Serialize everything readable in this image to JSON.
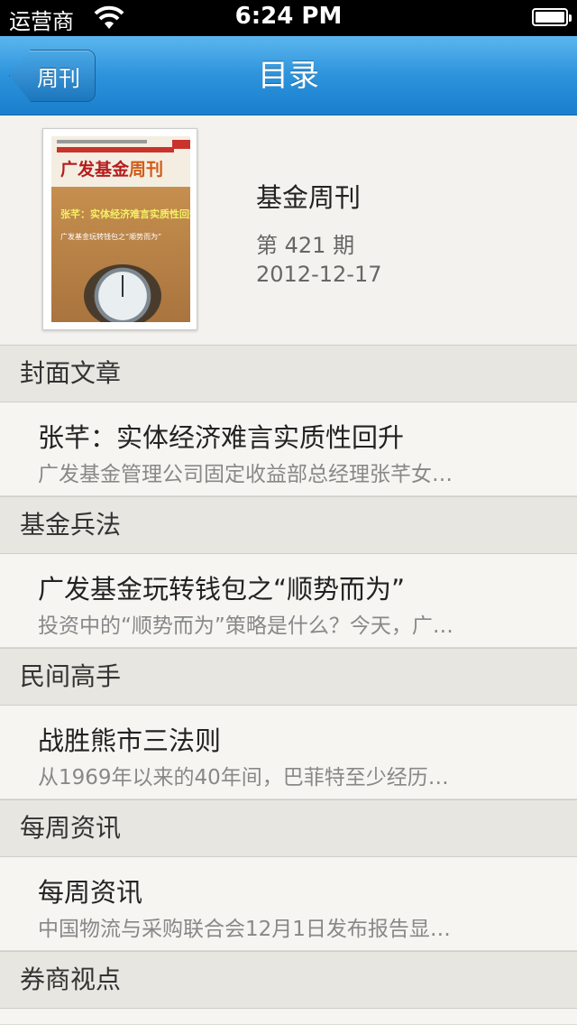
{
  "status_bar": {
    "carrier": "运营商",
    "time": "6:24 PM"
  },
  "nav": {
    "back_label": "周刊",
    "title": "目录"
  },
  "issue": {
    "title": "基金周刊",
    "number": "第 421 期",
    "date": "2012-12-17",
    "cover": {
      "logo_main": "广发基金",
      "logo_accent": "周刊",
      "headline": "张芊：实体经济难言实质性回升",
      "subline": "广发基金玩转钱包之“顺势而为”"
    }
  },
  "sections": [
    {
      "header": "封面文章",
      "articles": [
        {
          "title": "张芊：实体经济难言实质性回升",
          "summary": "广发基金管理公司固定收益部总经理张芊女…"
        }
      ]
    },
    {
      "header": "基金兵法",
      "articles": [
        {
          "title": "广发基金玩转钱包之“顺势而为”",
          "summary": "投资中的“顺势而为”策略是什么？今天，广…"
        }
      ]
    },
    {
      "header": "民间高手",
      "articles": [
        {
          "title": "战胜熊市三法则",
          "summary": "从1969年以来的40年间，巴菲特至少经历…"
        }
      ]
    },
    {
      "header": "每周资讯",
      "articles": [
        {
          "title": "每周资讯",
          "summary": "中国物流与采购联合会12月1日发布报告显…"
        }
      ]
    },
    {
      "header": "券商视点",
      "articles": []
    }
  ]
}
